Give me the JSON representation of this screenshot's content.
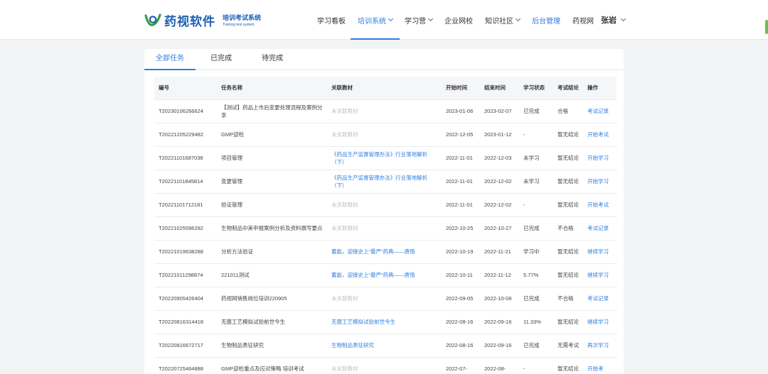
{
  "brand": {
    "name": "药视软件",
    "sub_cn": "培训考试系统",
    "sub_en": "Training test system",
    "color": "#1a5fb4",
    "accent": "#2f7ee0"
  },
  "nav": [
    {
      "label": "学习看板",
      "dropdown": false,
      "state": "normal"
    },
    {
      "label": "培训系统",
      "dropdown": true,
      "state": "active"
    },
    {
      "label": "学习营",
      "dropdown": true,
      "state": "normal"
    },
    {
      "label": "企业网校",
      "dropdown": false,
      "state": "normal"
    },
    {
      "label": "知识社区",
      "dropdown": true,
      "state": "normal"
    },
    {
      "label": "后台管理",
      "dropdown": false,
      "state": "blue"
    },
    {
      "label": "药视网",
      "dropdown": false,
      "state": "normal"
    }
  ],
  "user": {
    "name": "张岩"
  },
  "tabs": [
    {
      "label": "全部任务",
      "active": true
    },
    {
      "label": "已完成",
      "active": false
    },
    {
      "label": "待完成",
      "active": false
    }
  ],
  "table": {
    "headers": [
      "编号",
      "任务名称",
      "关联教材",
      "开始时间",
      "结束时间",
      "学习状态",
      "考试结论",
      "操作"
    ],
    "rows": [
      {
        "id": "T20230106266624",
        "name": "【测试】药品上市后变更处理流程及案例分享",
        "material": "未关联教材",
        "material_linked": false,
        "start": "2023-01-06",
        "end": "2023-02-07",
        "status": "已完成",
        "result": "合格",
        "action": "考试记录"
      },
      {
        "id": "T20221205229482",
        "name": "GMP迎检",
        "material": "未关联教材",
        "material_linked": false,
        "start": "2022-12-05",
        "end": "2023-01-12",
        "status": "-",
        "result": "暂无结论",
        "action": "开始考试"
      },
      {
        "id": "T20221101687038",
        "name": "项目管理",
        "material": "《药品生产监督管理办法》行业落地解析（下）",
        "material_linked": true,
        "start": "2022-11-01",
        "end": "2022-12-03",
        "status": "未学习",
        "result": "暂无结论",
        "action": "开始学习"
      },
      {
        "id": "T20221101845814",
        "name": "变更管理",
        "material": "《药品生产监督管理办法》行业落地解析（下）",
        "material_linked": true,
        "start": "2022-11-01",
        "end": "2022-12-02",
        "status": "未学习",
        "result": "暂无结论",
        "action": "开始学习"
      },
      {
        "id": "T20221101712181",
        "name": "验证管理",
        "material": "未关联教材",
        "material_linked": false,
        "start": "2022-11-01",
        "end": "2022-12-02",
        "status": "-",
        "result": "暂无结论",
        "action": "开始考试"
      },
      {
        "id": "T20221025596282",
        "name": "生物制品中美申报案例分析及资料撰写要点",
        "material": "未关联教材",
        "material_linked": false,
        "start": "2022-10-25",
        "end": "2022-10-27",
        "status": "已完成",
        "result": "不合格",
        "action": "考试记录"
      },
      {
        "id": "T20221019638288",
        "name": "分析方法验证",
        "material": "蓄能，迎接史上“最严”药典——唐悟",
        "material_linked": true,
        "start": "2022-10-19",
        "end": "2022-11-21",
        "status": "学习中",
        "result": "暂无结论",
        "action": "继续学习"
      },
      {
        "id": "T20221011298874",
        "name": "221011测试",
        "material": "蓄能，迎接史上“最严”药典——唐悟",
        "material_linked": true,
        "start": "2022-10-11",
        "end": "2022-11-12",
        "status": "5.77%",
        "result": "暂无结论",
        "action": "继续学习"
      },
      {
        "id": "T20220905426404",
        "name": "药视网销售岗位培训220905",
        "material": "未关联教材",
        "material_linked": false,
        "start": "2022-09-05",
        "end": "2022-10-08",
        "status": "已完成",
        "result": "不合格",
        "action": "考试记录"
      },
      {
        "id": "T20220816314418",
        "name": "无菌工艺模拟试验前世今生",
        "material": "无菌工艺模拟试验前世今生",
        "material_linked": true,
        "start": "2022-08-16",
        "end": "2022-09-16",
        "status": "11.33%",
        "result": "暂无结论",
        "action": "继续学习"
      },
      {
        "id": "T20220816672717",
        "name": "生物制品表征研究",
        "material": "生物制品表征研究",
        "material_linked": true,
        "start": "2022-08-16",
        "end": "2022-09-16",
        "status": "已完成",
        "result": "无需考试",
        "action": "再次学习"
      },
      {
        "id": "T20220725464888",
        "name": "GMP迎检重点及应对策略 培训考试",
        "material": "未关联教材",
        "material_linked": false,
        "start": "2022-07-",
        "end": "2022-08-",
        "status": "-",
        "result": "暂无结论",
        "action": "开始考"
      }
    ]
  }
}
